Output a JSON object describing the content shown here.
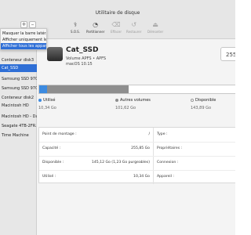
{
  "window": {
    "title": "Utilitaire de disque"
  },
  "toolbar": {
    "tools": [
      {
        "label": "S.O.S.",
        "icon": "stethoscope-icon",
        "glyph": "⚕"
      },
      {
        "label": "Partitionner",
        "icon": "pie-chart-icon",
        "glyph": "◔"
      },
      {
        "label": "Effacer",
        "icon": "erase-icon",
        "glyph": "⌫"
      },
      {
        "label": "Restaurer",
        "icon": "restore-icon",
        "glyph": "↺"
      },
      {
        "label": "Démonter",
        "icon": "eject-icon",
        "glyph": "⏏"
      }
    ],
    "add_glyph": "+",
    "remove_glyph": "–"
  },
  "menu": {
    "items": [
      {
        "label": "Masquer la barre latérale"
      },
      {
        "label": "Afficher uniquement les volumes"
      },
      {
        "label": "Afficher tous les appareils"
      }
    ]
  },
  "sidebar": {
    "items": [
      {
        "label": "Conteneur disk3"
      },
      {
        "label": "Cat_SSD"
      },
      {
        "label": "Samsung SSD 970 EVO - Don..."
      },
      {
        "label": "Samsung SSD 970 E..."
      },
      {
        "label": "Conteneur disk2"
      },
      {
        "label": "Macintosh HD"
      },
      {
        "label": "Macintosh HD - Data"
      },
      {
        "label": "Seagate 4TB-2FR..."
      },
      {
        "label": "Time Machine"
      }
    ]
  },
  "disk": {
    "name": "Cat_SSD",
    "type": "Volume APFS • APFS",
    "os": "macOS 10.15",
    "capacity_short": "255"
  },
  "usage": {
    "used_label": "Utilisé",
    "used_value": "10,34 Go",
    "used_fraction": 0.04,
    "used_color": "#3d8be0",
    "others_label": "Autres volumes",
    "others_value": "101,62 Go",
    "others_fraction": 0.4,
    "others_color": "#8e8e8e",
    "free_label": "Disponible",
    "free_value": "143,89 Go",
    "free_color": "#ffffff"
  },
  "info": {
    "left": [
      {
        "key": "Point de montage :",
        "value": "/"
      },
      {
        "key": "Capacité :",
        "value": "255,85 Go"
      },
      {
        "key": "Disponible :",
        "value": "145,12 Go (1,23 Go purgeables)"
      },
      {
        "key": "Utilisé :",
        "value": "10,34 Go"
      }
    ],
    "right": [
      {
        "key": "Type :",
        "value": ""
      },
      {
        "key": "Propriétaires :",
        "value": ""
      },
      {
        "key": "Connexion :",
        "value": ""
      },
      {
        "key": "Appareil :",
        "value": ""
      }
    ]
  }
}
